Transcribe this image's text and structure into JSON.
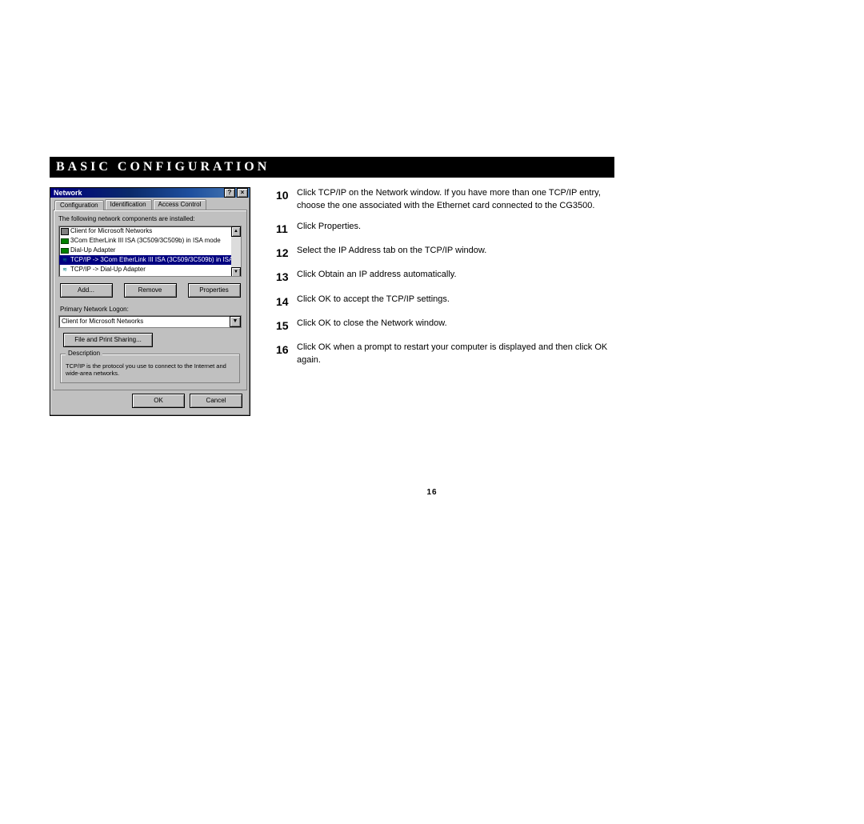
{
  "page": {
    "title": "BASIC CONFIGURATION",
    "number": "16"
  },
  "dialog": {
    "window_title": "Network",
    "help_label": "?",
    "close_label": "×",
    "tabs": [
      "Configuration",
      "Identification",
      "Access Control"
    ],
    "list_hint": "The following network components are installed:",
    "components": [
      {
        "icon": "pc",
        "label": "Client for Microsoft Networks",
        "selected": false
      },
      {
        "icon": "card",
        "label": "3Com EtherLink III ISA (3C509/3C509b) in ISA mode",
        "selected": false
      },
      {
        "icon": "card",
        "label": "Dial-Up Adapter",
        "selected": false
      },
      {
        "icon": "net",
        "label": "TCP/IP -> 3Com EtherLink III ISA (3C509/3C509b) in ISA",
        "selected": true
      },
      {
        "icon": "net",
        "label": "TCP/IP -> Dial-Up Adapter",
        "selected": false
      }
    ],
    "add_button": "Add...",
    "remove_button": "Remove",
    "properties_button": "Properties",
    "logon_label": "Primary Network Logon:",
    "logon_value": "Client for Microsoft Networks",
    "file_print_button": "File and Print Sharing...",
    "description_label": "Description",
    "description_text": "TCP/IP is the protocol you use to connect to the Internet and wide-area networks.",
    "ok_button": "OK",
    "cancel_button": "Cancel"
  },
  "steps": [
    {
      "n": "10",
      "t": "Click TCP/IP on the Network window. If you have more than one TCP/IP entry, choose the one associated with the Ethernet card connected to the CG3500."
    },
    {
      "n": "11",
      "t": "Click Properties."
    },
    {
      "n": "12",
      "t": "Select the IP Address tab on the TCP/IP window."
    },
    {
      "n": "13",
      "t": "Click Obtain an IP address automatically."
    },
    {
      "n": "14",
      "t": "Click OK to accept the TCP/IP settings."
    },
    {
      "n": "15",
      "t": "Click OK to close the Network window."
    },
    {
      "n": "16",
      "t": "Click OK when a prompt to restart your computer is displayed and then click OK again."
    }
  ]
}
